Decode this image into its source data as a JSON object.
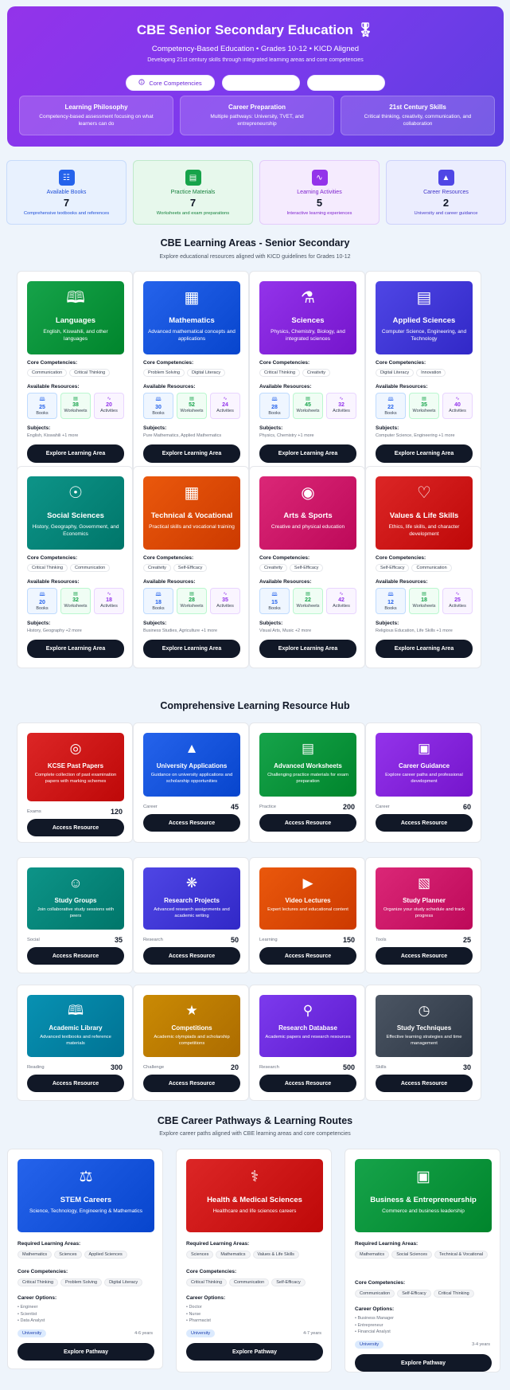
{
  "hero": {
    "title": "CBE Senior Secondary Education 🎖",
    "subtitle": "Competency-Based Education • Grades 10-12 • KICD Aligned",
    "description": "Developing 21st century skills through integrated learning areas and core competencies",
    "buttons": [
      {
        "label": "Core Competencies",
        "icon": "info-icon"
      },
      {
        "label": ""
      },
      {
        "label": ""
      }
    ],
    "cards": [
      {
        "title": "Learning Philosophy",
        "desc": "Competency-based assessment focusing on what learners can do"
      },
      {
        "title": "Career Preparation",
        "desc": "Multiple pathways: University, TVET, and entrepreneurship"
      },
      {
        "title": "21st Century Skills",
        "desc": "Critical thinking, creativity, communication, and collaboration"
      }
    ]
  },
  "stats": [
    {
      "label": "Available Books",
      "value": "7",
      "desc": "Comprehensive textbooks and references",
      "color": "#2563eb",
      "icon": "book-icon"
    },
    {
      "label": "Practice Materials",
      "value": "7",
      "desc": "Worksheets and exam preparations",
      "color": "#16a34a",
      "icon": "document-icon"
    },
    {
      "label": "Learning Activities",
      "value": "5",
      "desc": "Interactive learning experiences",
      "color": "#9333ea",
      "icon": "activity-icon"
    },
    {
      "label": "Career Resources",
      "value": "2",
      "desc": "University and career guidance",
      "color": "#4f46e5",
      "icon": "graduation-cap-icon"
    }
  ],
  "areas_section": {
    "title": "CBE Learning Areas - Senior Secondary",
    "subtitle": "Explore educational resources aligned with KICD guidelines for Grades 10-12",
    "competencies_label": "Core Competencies:",
    "resources_label": "Available Resources:",
    "subjects_label": "Subjects:",
    "books_label": "Books",
    "worksheets_label": "Worksheets",
    "activities_label": "Activities",
    "button_label": "Explore Learning Area"
  },
  "areas": [
    {
      "name": "Languages",
      "desc": "English, Kiswahili, and other languages",
      "chips": [
        "Communication",
        "Critical Thinking"
      ],
      "books": "25",
      "worksheets": "38",
      "activities": "20",
      "subjects": "English, Kiswahili +1 more",
      "color": "#16a34a",
      "icon": "book-open-icon"
    },
    {
      "name": "Mathematics",
      "desc": "Advanced mathematical concepts and applications",
      "chips": [
        "Problem Solving",
        "Digital Literacy"
      ],
      "books": "30",
      "worksheets": "52",
      "activities": "24",
      "subjects": "Pure Mathematics, Applied Mathematics",
      "color": "#2563eb",
      "icon": "calculator-icon"
    },
    {
      "name": "Sciences",
      "desc": "Physics, Chemistry, Biology, and integrated sciences",
      "chips": [
        "Critical Thinking",
        "Creativity"
      ],
      "books": "28",
      "worksheets": "45",
      "activities": "32",
      "subjects": "Physics, Chemistry +1 more",
      "color": "#9333ea",
      "icon": "microscope-icon"
    },
    {
      "name": "Applied Sciences",
      "desc": "Computer Science, Engineering, and Technology",
      "chips": [
        "Digital Literacy",
        "Innovation"
      ],
      "books": "22",
      "worksheets": "35",
      "activities": "40",
      "subjects": "Computer Science, Engineering +1 more",
      "color": "#4f46e5",
      "icon": "server-icon"
    },
    {
      "name": "Social Sciences",
      "desc": "History, Geography, Government, and Economics",
      "chips": [
        "Critical Thinking",
        "Communication"
      ],
      "books": "20",
      "worksheets": "32",
      "activities": "18",
      "subjects": "History, Geography +2 more",
      "color": "#0d9488",
      "icon": "map-pin-icon"
    },
    {
      "name": "Technical & Vocational",
      "desc": "Practical skills and vocational training",
      "chips": [
        "Creativity",
        "Self-Efficacy"
      ],
      "books": "18",
      "worksheets": "28",
      "activities": "35",
      "subjects": "Business Studies, Agriculture +1 more",
      "color": "#ea580c",
      "icon": "building-icon"
    },
    {
      "name": "Arts & Sports",
      "desc": "Creative and physical education",
      "chips": [
        "Creativity",
        "Self-Efficacy"
      ],
      "books": "15",
      "worksheets": "22",
      "activities": "42",
      "subjects": "Visual Arts, Music +2 more",
      "color": "#db2777",
      "icon": "palette-icon"
    },
    {
      "name": "Values & Life Skills",
      "desc": "Ethics, life skills, and character development",
      "chips": [
        "Self-Efficacy",
        "Communication"
      ],
      "books": "12",
      "worksheets": "18",
      "activities": "25",
      "subjects": "Religious Education, Life Skills +1 more",
      "color": "#dc2626",
      "icon": "heart-icon"
    }
  ],
  "hub": {
    "title": "Comprehensive Learning Resource Hub",
    "button_label": "Access Resource",
    "items": [
      {
        "name": "KCSE Past Papers",
        "desc": "Complete collection of past examination papers with marking schemes",
        "category": "Exams",
        "count": "120",
        "color": "#dc2626",
        "icon": "target-icon"
      },
      {
        "name": "University Applications",
        "desc": "Guidance on university applications and scholarship opportunities",
        "category": "Career",
        "count": "45",
        "color": "#2563eb",
        "icon": "graduation-cap-icon"
      },
      {
        "name": "Advanced Worksheets",
        "desc": "Challenging practice materials for exam preparation",
        "category": "Practice",
        "count": "200",
        "color": "#16a34a",
        "icon": "document-icon"
      },
      {
        "name": "Career Guidance",
        "desc": "Explore career paths and professional development",
        "category": "Career",
        "count": "60",
        "color": "#9333ea",
        "icon": "briefcase-icon"
      },
      {
        "name": "Study Groups",
        "desc": "Join collaborative study sessions with peers",
        "category": "Social",
        "count": "35",
        "color": "#0d9488",
        "icon": "users-icon"
      },
      {
        "name": "Research Projects",
        "desc": "Advanced research assignments and academic writing",
        "category": "Research",
        "count": "50",
        "color": "#4f46e5",
        "icon": "brain-icon"
      },
      {
        "name": "Video Lectures",
        "desc": "Expert lectures and educational content",
        "category": "Learning",
        "count": "150",
        "color": "#ea580c",
        "icon": "video-icon"
      },
      {
        "name": "Study Planner",
        "desc": "Organize your study schedule and track progress",
        "category": "Tools",
        "count": "25",
        "color": "#db2777",
        "icon": "calendar-icon"
      },
      {
        "name": "Academic Library",
        "desc": "Advanced textbooks and reference materials",
        "category": "Reading",
        "count": "300",
        "color": "#0891b2",
        "icon": "book-open-icon"
      },
      {
        "name": "Competitions",
        "desc": "Academic olympiads and scholarship competitions",
        "category": "Challenge",
        "count": "20",
        "color": "#ca8a04",
        "icon": "trophy-icon"
      },
      {
        "name": "Research Database",
        "desc": "Academic papers and research resources",
        "category": "Research",
        "count": "500",
        "color": "#7c3aed",
        "icon": "search-icon"
      },
      {
        "name": "Study Techniques",
        "desc": "Effective learning strategies and time management",
        "category": "Skills",
        "count": "30",
        "color": "#4b5563",
        "icon": "clock-icon"
      }
    ]
  },
  "careers": {
    "title": "CBE Career Pathways & Learning Routes",
    "subtitle": "Explore career paths aligned with CBE learning areas and core competencies",
    "areas_label": "Required Learning Areas:",
    "competencies_label": "Core Competencies:",
    "options_label": "Career Options:",
    "button_label": "Explore Pathway",
    "items": [
      {
        "name": "STEM Careers",
        "desc": "Science, Technology, Engineering & Mathematics",
        "areas": [
          "Mathematics",
          "Sciences",
          "Applied Sciences"
        ],
        "competencies": [
          "Critical Thinking",
          "Problem Solving",
          "Digital Literacy"
        ],
        "options": [
          "• Engineer",
          "• Scientist",
          "• Data Analyst"
        ],
        "badge": "University",
        "duration": "4-6 years",
        "color": "#2563eb",
        "icon": "beaker-icon"
      },
      {
        "name": "Health & Medical Sciences",
        "desc": "Healthcare and life sciences careers",
        "areas": [
          "Sciences",
          "Mathematics",
          "Values & Life Skills"
        ],
        "competencies": [
          "Critical Thinking",
          "Communication",
          "Self-Efficacy"
        ],
        "options": [
          "• Doctor",
          "• Nurse",
          "• Pharmacist"
        ],
        "badge": "University",
        "duration": "4-7 years",
        "color": "#dc2626",
        "icon": "stethoscope-icon"
      },
      {
        "name": "Business & Entrepreneurship",
        "desc": "Commerce and business leadership",
        "areas": [
          "Mathematics",
          "Social Sciences",
          "Technical & Vocational"
        ],
        "competencies": [
          "Communication",
          "Self-Efficacy",
          "Critical Thinking"
        ],
        "options": [
          "• Business Manager",
          "• Entrepreneur",
          "• Financial Analyst"
        ],
        "badge": "University",
        "duration": "3-4 years",
        "color": "#16a34a",
        "icon": "briefcase-icon"
      }
    ]
  }
}
